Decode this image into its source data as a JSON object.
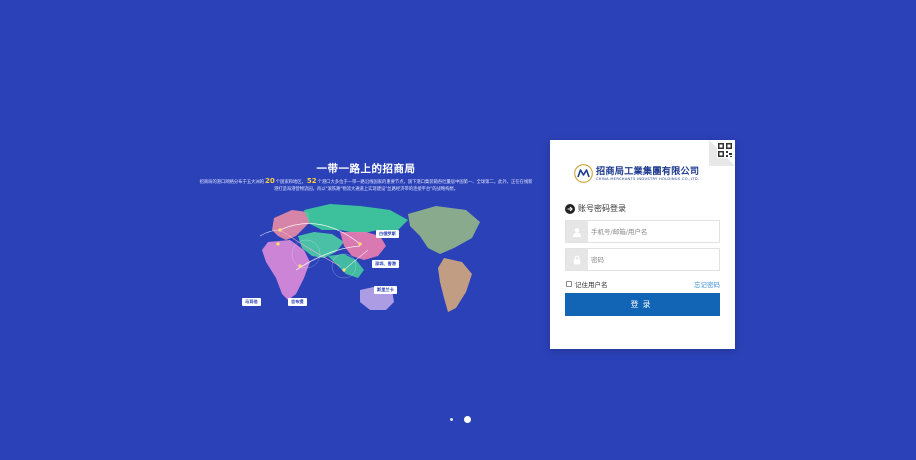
{
  "banner": {
    "title": "一带一路上的招商局",
    "desc_pre": "招商局的港口网络分布于五大洲的",
    "count_countries": "20",
    "desc_mid": "个国家和地区，",
    "count_ports": "52",
    "desc_post": "个港口大多位于一带一路沿线国家的重要节点，旗下港口集装箱吞吐量居中国第一、全球第二。此外，正在在线新港打造海港营物流园，再以\"滚铁路\"物流大通道上实现建设\"丝路经济带的连接平台\"的战略构想。",
    "tags": {
      "a": "白俄罗斯",
      "b": "深圳、香港",
      "c": "斯里兰卡",
      "d": "马耳他",
      "e": "吉布提"
    }
  },
  "login": {
    "logo_cn": "招商局工業集團有限公司",
    "logo_en": "CHINA MERCHANTS INDUSTRY HOLDINGS CO.,LTD.",
    "heading": "账号密码登录",
    "username_placeholder": "手机号/邮箱/用户名",
    "password_placeholder": "密码",
    "remember_label": "记住用户名",
    "forgot_label": "忘记密码",
    "submit_label": "登录"
  },
  "colors": {
    "background": "#2b41b8",
    "primary_button": "#1265b5",
    "link": "#3a8fd8"
  }
}
